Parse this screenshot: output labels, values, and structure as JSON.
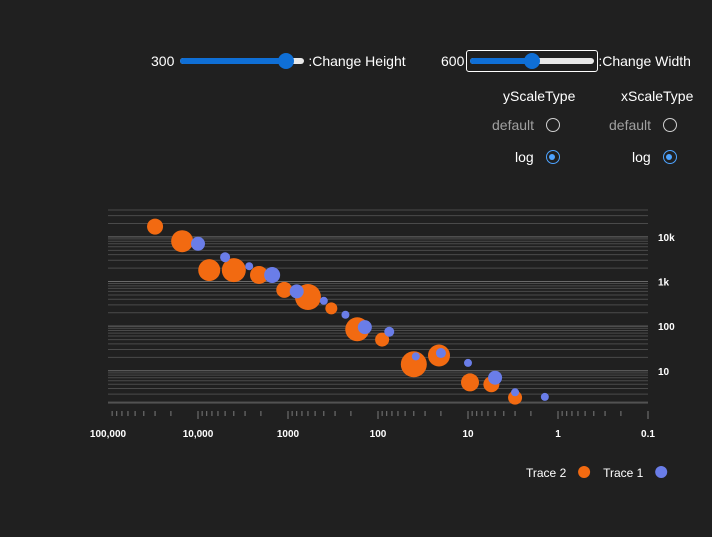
{
  "controls": {
    "height": {
      "value": "300",
      "label": ":Change Height",
      "fraction": 0.85
    },
    "width": {
      "value": "600",
      "label": ":Change Width",
      "fraction": 0.5
    }
  },
  "radios": {
    "y": {
      "title": "yScaleType",
      "options": [
        {
          "label": "default",
          "selected": false
        },
        {
          "label": "log",
          "selected": true
        }
      ]
    },
    "x": {
      "title": "xScaleType",
      "options": [
        {
          "label": "default",
          "selected": false
        },
        {
          "label": "log",
          "selected": true
        }
      ]
    }
  },
  "chart_data": {
    "type": "scatter",
    "x_scale": "log",
    "y_scale": "log",
    "x_reversed": true,
    "xlim": [
      100000,
      0.1
    ],
    "ylim": [
      2,
      40000
    ],
    "x_tick_labels": [
      "100,000",
      "10,000",
      "1000",
      "100",
      "10",
      "1",
      "0.1"
    ],
    "x_ticks": [
      100000,
      10000,
      1000,
      100,
      10,
      1,
      0.1
    ],
    "y_tick_labels": [
      "10k",
      "1k",
      "100",
      "10"
    ],
    "y_ticks": [
      10000,
      1000,
      100,
      10
    ],
    "grid": true,
    "legend_placement": "bottom-right",
    "series": [
      {
        "name": "Trace 2",
        "color": "#f26a11",
        "points": [
          {
            "x": 30000,
            "y": 17000,
            "size": 8
          },
          {
            "x": 15000,
            "y": 8000,
            "size": 11
          },
          {
            "x": 7500,
            "y": 1800,
            "size": 11
          },
          {
            "x": 4000,
            "y": 1800,
            "size": 12
          },
          {
            "x": 2100,
            "y": 1400,
            "size": 9
          },
          {
            "x": 1100,
            "y": 650,
            "size": 8
          },
          {
            "x": 600,
            "y": 450,
            "size": 13
          },
          {
            "x": 330,
            "y": 250,
            "size": 6
          },
          {
            "x": 170,
            "y": 85,
            "size": 12
          },
          {
            "x": 90,
            "y": 50,
            "size": 7
          },
          {
            "x": 40,
            "y": 14,
            "size": 13
          },
          {
            "x": 21,
            "y": 22,
            "size": 11
          },
          {
            "x": 9.5,
            "y": 5.5,
            "size": 9
          },
          {
            "x": 5.5,
            "y": 5,
            "size": 8
          },
          {
            "x": 3,
            "y": 2.5,
            "size": 7
          }
        ]
      },
      {
        "name": "Trace 1",
        "color": "#6a7de8",
        "points": [
          {
            "x": 10000,
            "y": 7000,
            "size": 7
          },
          {
            "x": 5000,
            "y": 3500,
            "size": 5
          },
          {
            "x": 2700,
            "y": 2200,
            "size": 4
          },
          {
            "x": 1500,
            "y": 1400,
            "size": 8
          },
          {
            "x": 800,
            "y": 600,
            "size": 7
          },
          {
            "x": 400,
            "y": 370,
            "size": 4
          },
          {
            "x": 230,
            "y": 180,
            "size": 4
          },
          {
            "x": 140,
            "y": 95,
            "size": 7
          },
          {
            "x": 75,
            "y": 75,
            "size": 5
          },
          {
            "x": 38,
            "y": 21,
            "size": 4
          },
          {
            "x": 20,
            "y": 25,
            "size": 5
          },
          {
            "x": 10,
            "y": 15,
            "size": 4
          },
          {
            "x": 5,
            "y": 7,
            "size": 7
          },
          {
            "x": 3,
            "y": 3.3,
            "size": 4
          },
          {
            "x": 1.4,
            "y": 2.6,
            "size": 4
          }
        ]
      }
    ]
  }
}
